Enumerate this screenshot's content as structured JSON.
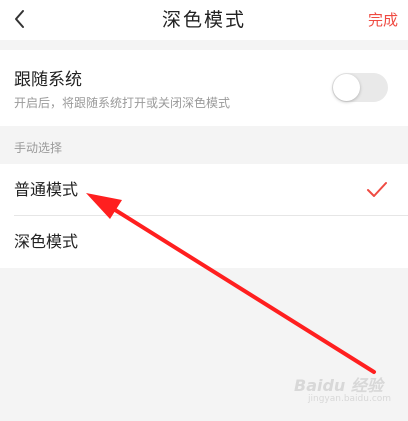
{
  "header": {
    "title": "深色模式",
    "done_label": "完成",
    "back_icon": "chevron-left-icon"
  },
  "follow_system": {
    "title": "跟随系统",
    "description": "开启后，将跟随系统打开或关闭深色模式",
    "enabled": false
  },
  "manual": {
    "section_label": "手动选择",
    "options": [
      {
        "label": "普通模式",
        "selected": true
      },
      {
        "label": "深色模式",
        "selected": false
      }
    ]
  },
  "watermark": {
    "brand": "Baidu 经验",
    "url": "jingyan.baidu.com"
  },
  "colors": {
    "accent": "#ef4b42",
    "arrow": "#ff1f1f",
    "background": "#f4f4f4",
    "muted_text": "#9a9a9a"
  }
}
